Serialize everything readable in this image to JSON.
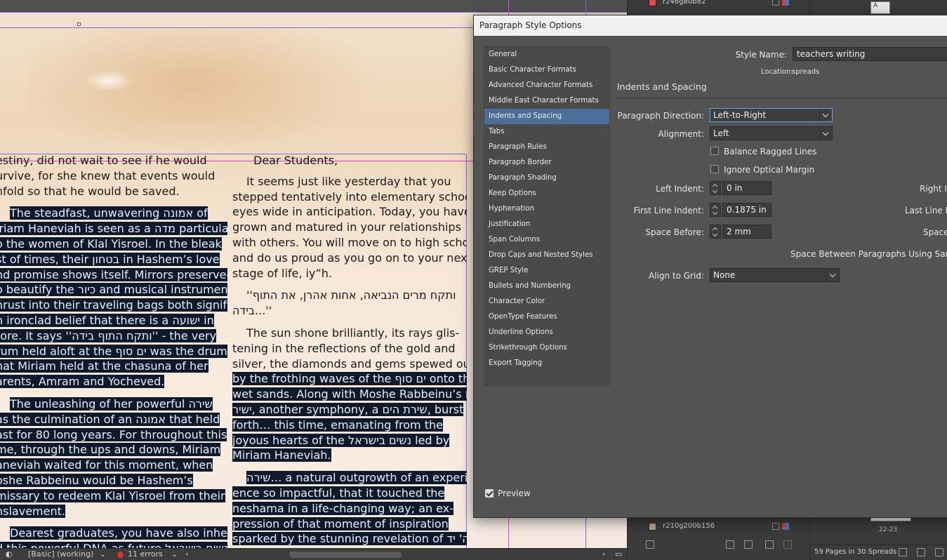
{
  "document": {
    "left_column": [
      {
        "highlight": false,
        "lines": [
          "estiny, did not wait to see if he would",
          "urvive, for she knew that events would",
          "nfold so that he would be saved."
        ]
      },
      {
        "highlight": true,
        "lines": [
          "The steadfast, unwavering אמונה of",
          "iriam Haneviah is seen as a מדה particular",
          "o the women of Klal Yisroel. In the bleak",
          "st of times, their בטחון in Hashem’s love",
          "nd promise shows itself. Mirrors preserved",
          "o beautify the כיור and musical instruments",
          "hrust into their traveling bags both signify",
          "n ironclad belief that there is a ישועה in",
          "tore. It says ''ותקח התוף בידה'' - the very",
          "rum held aloft at the ים סוף was the drum",
          "hat Miriam held at the chasuna of her",
          "arents, Amram and Yocheved."
        ]
      },
      {
        "highlight": true,
        "lines": [
          "The unleashing of her powerful שירה",
          "as the culmination of an אמונה that held",
          "ast for 80 long years. For throughout this",
          "me, through the ups and downs, Miriam",
          "aneviah waited for this moment, when",
          "oshe Rabbeinu would be Hashem’s",
          "missary to redeem Klal Yisroel from their",
          "nslavement."
        ]
      },
      {
        "highlight": true,
        "lines": [
          "Dearest graduates, you have also inherit",
          "d this powerful DNA as future נשים בישראל"
        ]
      }
    ],
    "greeting": "Dear Students,",
    "right_column": [
      {
        "lines": [
          "It seems just like yesterday that you",
          "stepped tentatively into elementary school,",
          "eyes wide in anticipation. Today, you have",
          "grown and matured in your relationships",
          "with others. You will move on to high school",
          "and do us proud as you go on to your next",
          "stage of life, iy”h."
        ]
      },
      {
        "lines": [
          "''ותקח מרים הנביאה, אחות אהרן, את התוף",
          "בידה...''"
        ]
      },
      {
        "lines": [
          "The sun shone brilliantly, its rays glis-",
          "tening in the reflections of the gold and",
          "silver, the diamonds and gems spewed out",
          "by the frothing waves of the ים סוף onto the",
          "wet sands. Along with Moshe Rabbeinu’s אז",
          "ישיר, another symphony, a שירת הים, burst",
          "forth… this time, emanating from the",
          "joyous hearts of the נשים בישראל led by",
          "Miriam Haneviah."
        ]
      },
      {
        "lines": [
          "שירה… a natural outgrowth of an experi-",
          "ence so impactful, that it touched the",
          "neshama in a life-changing way; an ex-",
          "pression of that moment of inspiration",
          "sparked by the stunning revelation of ה' יד"
        ]
      }
    ]
  },
  "status_bar": {
    "style": "[Basic] (working)",
    "errors": "11 errors"
  },
  "swatches": {
    "top": "r246g80b82",
    "bottom": "r210g200b156",
    "top_color": "#e84b55",
    "bottom_color": "#b3a68a"
  },
  "pages": {
    "summary": "59 Pages in 30 Spreads",
    "page_label": "22-23"
  },
  "dialog": {
    "title": "Paragraph Style Options",
    "categories": [
      "General",
      "Basic Character Formats",
      "Advanced Character Formats",
      "Middle East Character Formats",
      "Indents and Spacing",
      "Tabs",
      "Paragraph Rules",
      "Paragraph Border",
      "Paragraph Shading",
      "Keep Options",
      "Hyphenation",
      "Justification",
      "Span Columns",
      "Drop Caps and Nested Styles",
      "GREP Style",
      "Bullets and Numbering",
      "Character Color",
      "OpenType Features",
      "Underline Options",
      "Strikethrough Options",
      "Export Tagging"
    ],
    "selected_category": "Indents and Spacing",
    "style_name_label": "Style Name:",
    "style_name_value": "teachers writing",
    "location_label": "Location:",
    "location_value": "spreads",
    "section_title": "Indents and Spacing",
    "paragraph_direction_label": "Paragraph Direction:",
    "paragraph_direction_value": "Left-to-Right",
    "alignment_label": "Alignment:",
    "alignment_value": "Left",
    "balance_ragged_label": "Balance Ragged Lines",
    "ignore_optical_label": "Ignore Optical Margin",
    "left_indent_label": "Left Indent:",
    "left_indent_value": "0 in",
    "first_line_indent_label": "First Line Indent:",
    "first_line_indent_value": "0.1875 in",
    "space_before_label": "Space Before:",
    "space_before_value": "2 mm",
    "right_indent_label": "Right In",
    "last_line_label": "Last Line I",
    "space_after_label": "Space",
    "space_between_label": "Space Between Paragraphs Using Same",
    "align_grid_label": "Align to Grid:",
    "align_grid_value": "None",
    "preview_label": "Preview",
    "preview_checked": true,
    "balance_checked": false,
    "ignore_checked": false
  }
}
